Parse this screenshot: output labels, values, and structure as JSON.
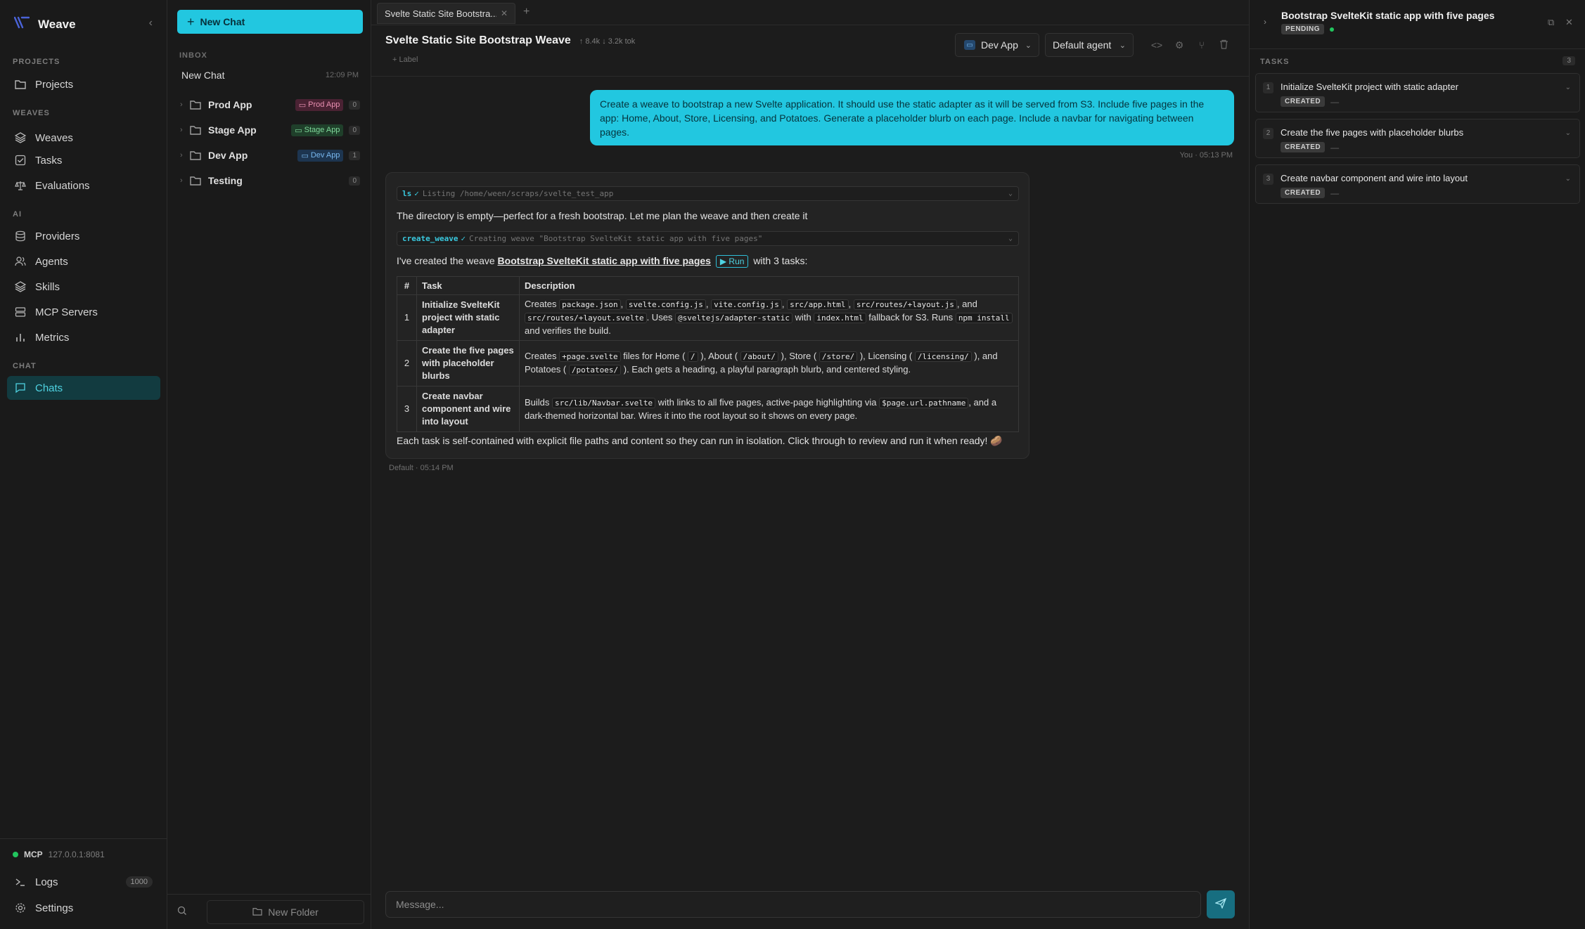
{
  "app": {
    "name": "Weave"
  },
  "sidebar": {
    "sections": {
      "projects": "PROJECTS",
      "weaves": "WEAVES",
      "ai": "AI",
      "chat": "CHAT"
    },
    "items": {
      "projects": "Projects",
      "weaves": "Weaves",
      "tasks": "Tasks",
      "evaluations": "Evaluations",
      "providers": "Providers",
      "agents": "Agents",
      "skills": "Skills",
      "mcp_servers": "MCP Servers",
      "metrics": "Metrics",
      "chats": "Chats"
    },
    "mcp": {
      "label": "MCP",
      "address": "127.0.0.1:8081",
      "status_color": "#22c55e"
    },
    "logs": {
      "label": "Logs",
      "count": "1000"
    },
    "settings": "Settings"
  },
  "folders": {
    "new_chat_button": "New Chat",
    "inbox_label": "INBOX",
    "inbox_chat": {
      "title": "New Chat",
      "time": "12:09 PM"
    },
    "items": [
      {
        "name": "Prod App",
        "tag": "Prod App",
        "count": "0",
        "tag_color": "#e88fb0"
      },
      {
        "name": "Stage App",
        "tag": "Stage App",
        "count": "0",
        "tag_color": "#7fd89a"
      },
      {
        "name": "Dev App",
        "tag": "Dev App",
        "count": "1",
        "tag_color": "#78b7ee"
      },
      {
        "name": "Testing",
        "tag": "",
        "count": "0"
      }
    ],
    "new_folder_button": "New Folder"
  },
  "main": {
    "tab": {
      "title": "Svelte Static Site Bootstra..."
    },
    "title": "Svelte Static Site Bootstrap Weave",
    "tokens": "↑ 8.4k ↓ 3.2k tok",
    "label_button": "+ Label",
    "project_select": "Dev App",
    "agent_select": "Default agent",
    "user_message": {
      "text": "Create a weave to bootstrap a new Svelte application. It should use the static adapter as it will be served from S3. Include five pages in the app: Home, About, Store, Licensing, and Potatoes. Generate a placeholder blurb on each page. Include a navbar for navigating between pages.",
      "meta": "You · 05:13 PM"
    },
    "assistant": {
      "tool1": {
        "name": "ls",
        "desc": "Listing /home/ween/scraps/svelte_test_app"
      },
      "para1": "The directory is empty—perfect for a fresh bootstrap. Let me plan the weave and then create it",
      "tool2": {
        "name": "create_weave",
        "desc": "Creating weave \"Bootstrap SvelteKit static app with five pages\""
      },
      "created_prefix": "I've created the weave",
      "weave_link": "Bootstrap SvelteKit static app with five pages",
      "run_button": "▶ Run",
      "created_suffix": "with 3 tasks:",
      "table": {
        "headers": [
          "#",
          "Task",
          "Description"
        ],
        "rows": [
          {
            "num": "1",
            "task": "Initialize SvelteKit project with static adapter",
            "d": [
              "Creates",
              "package.json",
              ",",
              "svelte.config.js",
              ",",
              "vite.config.js",
              ",",
              "src/app.html",
              ",",
              "src/routes/+layout.js",
              ", and",
              "src/routes/+layout.svelte",
              ". Uses",
              "@sveltejs/adapter-static",
              "with",
              "index.html",
              "fallback for S3. Runs",
              "npm install",
              "and verifies the build."
            ]
          },
          {
            "num": "2",
            "task": "Create the five pages with placeholder blurbs",
            "d": [
              "Creates",
              "+page.svelte",
              "files for Home (",
              "/",
              "), About (",
              "/about/",
              "), Store (",
              "/store/",
              "), Licensing (",
              "/licensing/",
              "), and Potatoes (",
              "/potatoes/",
              "). Each gets a heading, a playful paragraph blurb, and centered styling."
            ]
          },
          {
            "num": "3",
            "task": "Create navbar component and wire into layout",
            "d": [
              "Builds",
              "src/lib/Navbar.svelte",
              "with links to all five pages, active-page highlighting via",
              "$page.url.pathname",
              ", and a dark-themed horizontal bar. Wires it into the root layout so it shows on every page."
            ]
          }
        ]
      },
      "closing": "Each task is self-contained with explicit file paths and content so they can run in isolation. Click through to review and run it when ready! 🥔",
      "meta": "Default · 05:14 PM"
    },
    "composer": {
      "placeholder": "Message..."
    }
  },
  "right_panel": {
    "title": "Bootstrap SvelteKit static app with five pages",
    "status": "PENDING",
    "tasks_label": "TASKS",
    "tasks_count": "3",
    "tasks": [
      {
        "num": "1",
        "title": "Initialize SvelteKit project with static adapter",
        "status": "CREATED",
        "extra": "—"
      },
      {
        "num": "2",
        "title": "Create the five pages with placeholder blurbs",
        "status": "CREATED",
        "extra": "—"
      },
      {
        "num": "3",
        "title": "Create navbar component and wire into layout",
        "status": "CREATED",
        "extra": "—"
      }
    ]
  },
  "colors": {
    "accent": "#22c7e0",
    "active_nav_bg": "#123b40",
    "background": "#1c1c1c"
  }
}
